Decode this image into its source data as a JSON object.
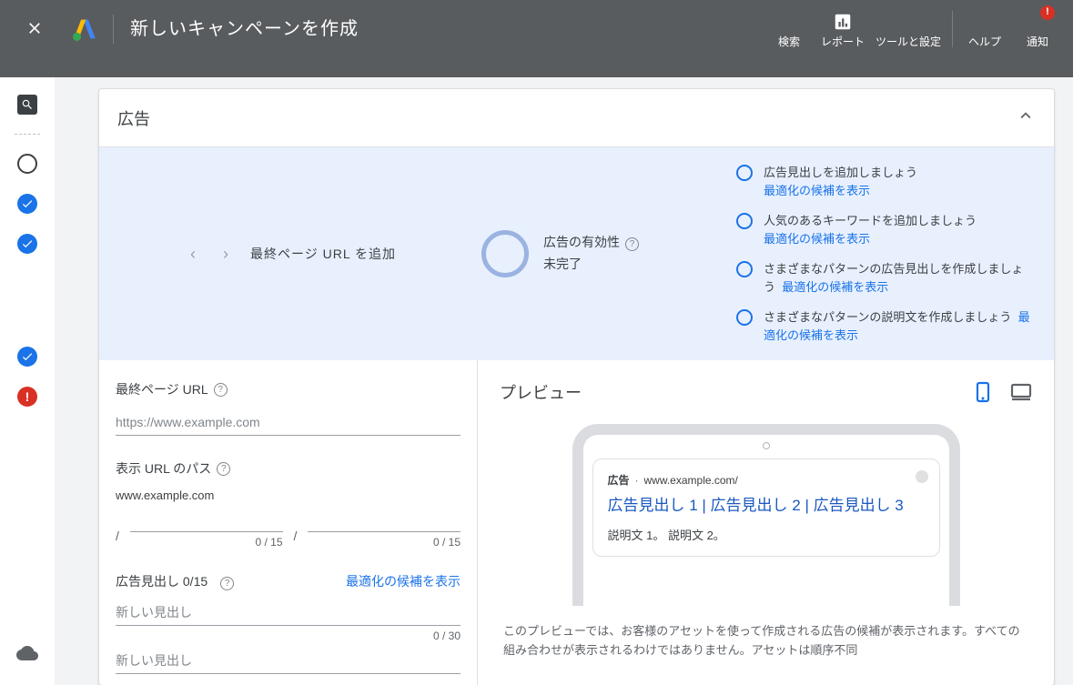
{
  "header": {
    "title": "新しいキャンペーンを作成",
    "nav": {
      "search": "検索",
      "reports": "レポート",
      "tools": "ツールと設定",
      "help": "ヘルプ",
      "notifications": "通知",
      "notif_badge": "!"
    }
  },
  "card": {
    "title": "広告"
  },
  "strength": {
    "nav_label": "最終ページ URL を追加",
    "title_line1": "広告の有効性",
    "title_line2": "未完了",
    "items": [
      {
        "text": "広告見出しを追加しましょう",
        "link": "最適化の候補を表示"
      },
      {
        "text": "人気のあるキーワードを追加しましょう",
        "link": "最適化の候補を表示"
      },
      {
        "text": "さまざまなパターンの広告見出しを作成しましょう",
        "link": "最適化の候補を表示"
      },
      {
        "text": "さまざまなパターンの説明文を作成しましょう",
        "link": "最適化の候補を表示"
      }
    ]
  },
  "form": {
    "final_url_label": "最終ページ URL",
    "final_url_placeholder": "https://www.example.com",
    "display_url_label": "表示 URL のパス",
    "display_url_base": "www.example.com",
    "path_slash": "/",
    "path_counter": "0 / 15",
    "headlines_label": "広告見出し 0/15",
    "headlines_link": "最適化の候補を表示",
    "headline_placeholder": "新しい見出し",
    "headline_counter": "0 / 30"
  },
  "preview": {
    "title": "プレビュー",
    "ad_badge": "広告",
    "ad_domain": "www.example.com/",
    "ad_headline": "広告見出し 1 | 広告見出し 2 | 広告見出し 3",
    "ad_desc": "説明文 1。 説明文 2。",
    "note": "このプレビューでは、お客様のアセットを使って作成される広告の候補が表示されます。すべての組み合わせが表示されるわけではありません。アセットは順序不同"
  }
}
